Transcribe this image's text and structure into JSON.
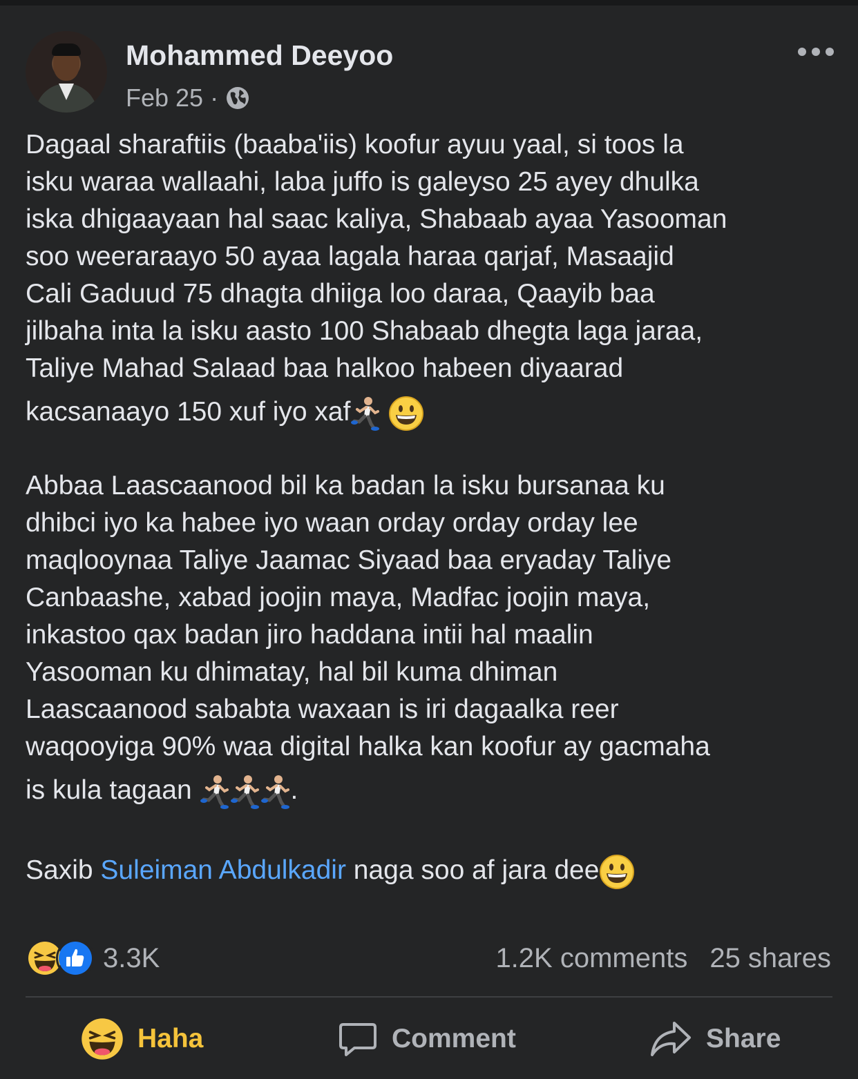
{
  "post": {
    "author": "Mohammed Deeyoo",
    "date": "Feb 25",
    "separator": "·",
    "audience_icon": "globe-icon",
    "more_icon": "more-options-icon",
    "paragraph1": {
      "lines": [
        "Dagaal sharaftiis (baaba'iis) koofur ayuu yaal, si toos la",
        "isku waraa wallaahi, laba  juffo is galeyso 25 ayey dhulka",
        "iska dhigaayaan hal saac kaliya, Shabaab ayaa Yasooman",
        "soo weeraraayo 50 ayaa lagala haraa qarjaf, Masaajid",
        "Cali Gaduud 75 dhagta dhiiga loo daraa, Qaayib baa",
        "jilbaha inta la isku aasto 100 Shabaab dhegta laga jaraa,",
        "Taliye Mahad Salaad baa halkoo habeen diyaarad"
      ],
      "last_line": "kacsanaayo 150 xuf iyo xaf"
    },
    "paragraph2": {
      "lines": [
        "Abbaa Laascaanood bil ka badan la isku bursanaa ku",
        "dhibci iyo ka habee iyo waan orday orday orday lee",
        "maqlooynaa Taliye Jaamac Siyaad baa eryaday Taliye",
        "Canbaashe, xabad joojin maya, Madfac joojin maya,",
        "inkastoo qax badan jiro haddana intii hal maalin",
        "Yasooman ku dhimatay, hal bil kuma dhiman",
        "Laascaanood sababta waxaan is iri dagaalka reer",
        "waqooyiga 90% waa digital halka kan koofur ay gacmaha"
      ],
      "last_line": "is kula tagaan",
      "last_line_end": "."
    },
    "paragraph3": {
      "prefix": "Saxib ",
      "mention": "Suleiman Abdulkadir",
      "suffix": " naga soo af jara dee"
    }
  },
  "stats": {
    "reaction_icons": [
      "haha-reaction-icon",
      "like-reaction-icon"
    ],
    "reaction_count": "3.3K",
    "comments": "1.2K comments",
    "shares": "25 shares"
  },
  "actions": {
    "haha": "Haha",
    "comment": "Comment",
    "share": "Share"
  },
  "colors": {
    "background": "#242526",
    "text": "#e4e6eb",
    "secondary": "#b0b3b8",
    "mention": "#5aa7ff",
    "haha": "#f5c33b",
    "like": "#1877f2"
  }
}
